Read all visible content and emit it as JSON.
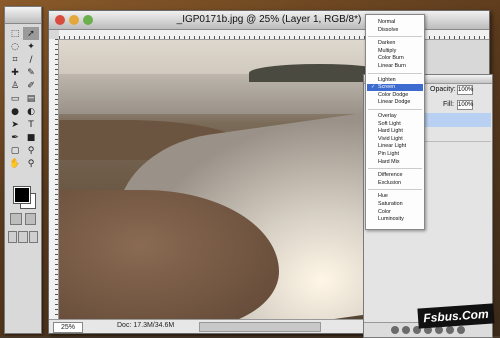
{
  "document": {
    "title": "_IGP0171b.jpg @ 25% (Layer 1, RGB/8*)",
    "zoom": "25%",
    "doc_info": "Doc: 17.3M/34.6M"
  },
  "tools": {
    "items": [
      "marquee",
      "move",
      "lasso",
      "magic-wand",
      "crop",
      "slice",
      "healing-brush",
      "brush",
      "clone-stamp",
      "history-brush",
      "eraser",
      "gradient",
      "blur",
      "dodge",
      "path-select",
      "type",
      "pen",
      "shape",
      "notes",
      "eyedropper",
      "hand",
      "zoom"
    ]
  },
  "layers_panel": {
    "opacity_label": "Opacity:",
    "opacity_value": "100%",
    "fill_label": "Fill:",
    "fill_value": "100%"
  },
  "blend_menu": {
    "selected": "Screen",
    "groups": [
      [
        "Normal",
        "Dissolve"
      ],
      [
        "Darken",
        "Multiply",
        "Color Burn",
        "Linear Burn"
      ],
      [
        "Lighten",
        "Screen",
        "Color Dodge",
        "Linear Dodge"
      ],
      [
        "Overlay",
        "Soft Light",
        "Hard Light",
        "Vivid Light",
        "Linear Light",
        "Pin Light",
        "Hard Mix"
      ],
      [
        "Difference",
        "Exclusion"
      ],
      [
        "Hue",
        "Saturation",
        "Color",
        "Luminosity"
      ]
    ]
  },
  "watermark": "Fsbus.Com",
  "colors": {
    "menu_highlight": "#3d6bd0",
    "layer_selected": "#b8d0f2"
  }
}
